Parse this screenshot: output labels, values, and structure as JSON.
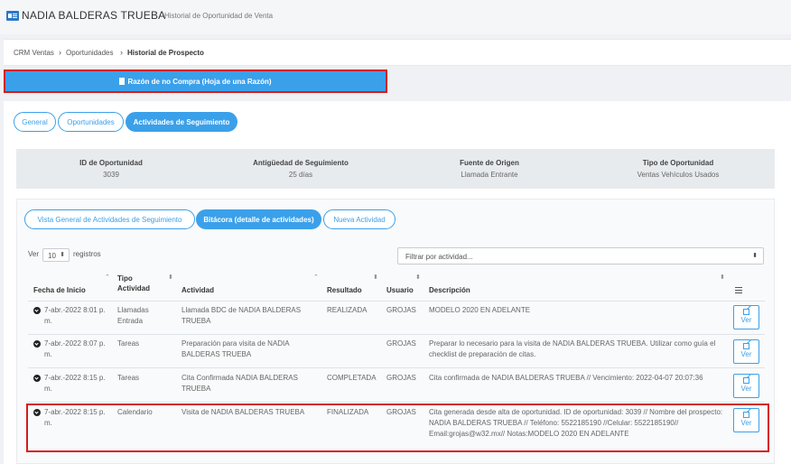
{
  "header": {
    "name": "NADIA BALDERAS TRUEBA",
    "subtitle": "Historial de Oportunidad de Venta"
  },
  "breadcrumb": [
    "CRM Ventas",
    "Oportunidades",
    "Historial de Prospecto"
  ],
  "banner": {
    "label": "Razón de no Compra (Hoja de una Razón)"
  },
  "main_tabs": [
    "General",
    "Oportunidades",
    "Actividades de Seguimiento"
  ],
  "summary": [
    {
      "label": "ID de Oportunidad",
      "value": "3039"
    },
    {
      "label": "Antigüedad de Seguimiento",
      "value": "25 días"
    },
    {
      "label": "Fuente de Origen",
      "value": "Llamada Entrante"
    },
    {
      "label": "Tipo de Oportunidad",
      "value": "Ventas Vehículos Usados"
    }
  ],
  "sub_tabs": [
    "Vista General de Actividades de Seguimiento",
    "Bitácora (detalle de actividades)",
    "Nueva Actividad"
  ],
  "controls": {
    "show_prefix": "Ver",
    "show_value": "10",
    "show_suffix": "registros",
    "filter_placeholder": "Filtrar por actividad..."
  },
  "columns": [
    "Fecha de Inicio",
    "Tipo Actividad",
    "Actividad",
    "Resultado",
    "Usuario",
    "Descripción"
  ],
  "rows": [
    {
      "fecha": "7-abr.-2022 8:01 p. m.",
      "tipo": "Llamadas Entrada",
      "actividad": "Llamada BDC de NADIA BALDERAS TRUEBA",
      "resultado": "REALIZADA",
      "usuario": "GROJAS",
      "descripcion": "MODELO 2020 EN ADELANTE"
    },
    {
      "fecha": "7-abr.-2022 8:07 p. m.",
      "tipo": "Tareas",
      "actividad": "Preparación para visita de NADIA BALDERAS TRUEBA",
      "resultado": "",
      "usuario": "GROJAS",
      "descripcion": "Preparar lo necesario para la visita de NADIA BALDERAS TRUEBA. Utilizar como guía el checklist de preparación de citas."
    },
    {
      "fecha": "7-abr.-2022 8:15 p. m.",
      "tipo": "Tareas",
      "actividad": "Cita Confirmada NADIA BALDERAS TRUEBA",
      "resultado": "COMPLETADA",
      "usuario": "GROJAS",
      "descripcion": "Cita confirmada de NADIA BALDERAS TRUEBA // Vencimiento: 2022-04-07 20:07:36"
    },
    {
      "fecha": "7-abr.-2022 8:15 p. m.",
      "tipo": "Calendario",
      "actividad": "Visita de NADIA BALDERAS TRUEBA",
      "resultado": "FINALIZADA",
      "usuario": "GROJAS",
      "descripcion": "Cita generada desde alta de oportunidad. ID de oportunidad: 3039 // Nombre del prospecto: NADIA BALDERAS TRUEBA // Teléfono: 5522185190 //Celular: 5522185190// Email:grojas@w32.mx// Notas:MODELO 2020 EN ADELANTE"
    }
  ],
  "view_label": "Ver",
  "colors": {
    "accent": "#3ba0ea",
    "highlight": "#d61b1b"
  }
}
